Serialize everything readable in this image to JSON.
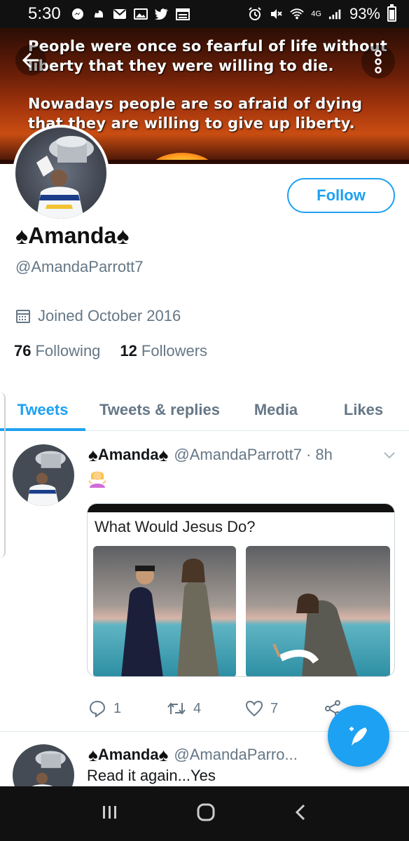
{
  "status_bar": {
    "time": "5:30",
    "network": "4G",
    "battery": "93%",
    "icons": [
      "messenger-icon",
      "notification-icon",
      "gmail-icon",
      "gallery-icon",
      "twitter-icon",
      "calendar-icon",
      "alarm-icon",
      "mute-icon",
      "wifi-icon",
      "signal-icon",
      "battery-icon"
    ]
  },
  "banner": {
    "quote_line1": "People were once so fearful of life without liberty that they were willing to die.",
    "quote_line2": "Nowadays people are so  afraid of dying that they are willing to give up liberty."
  },
  "profile": {
    "display_name": "Amanda",
    "name_decoration": "♠",
    "handle": "@AmandaParrott7",
    "joined": "Joined October 2016",
    "following_count": "76",
    "following_label": "Following",
    "followers_count": "12",
    "followers_label": "Followers",
    "follow_button": "Follow"
  },
  "tabs": [
    {
      "label": "Tweets",
      "active": true
    },
    {
      "label": "Tweets & replies",
      "active": false
    },
    {
      "label": "Media",
      "active": false
    },
    {
      "label": "Likes",
      "active": false
    }
  ],
  "tweets": [
    {
      "name": "Amanda",
      "handle": "@AmandaParrott7",
      "time": "· 8h",
      "emoji": "🤷‍♀️",
      "media_caption": "What Would Jesus Do?",
      "replies": "1",
      "retweets": "4",
      "likes": "7"
    },
    {
      "name": "Amanda",
      "handle": "@AmandaParro...",
      "text": "Read it again...Yes"
    }
  ],
  "colors": {
    "accent": "#1da1f2",
    "muted": "#657786",
    "text": "#14171a"
  }
}
